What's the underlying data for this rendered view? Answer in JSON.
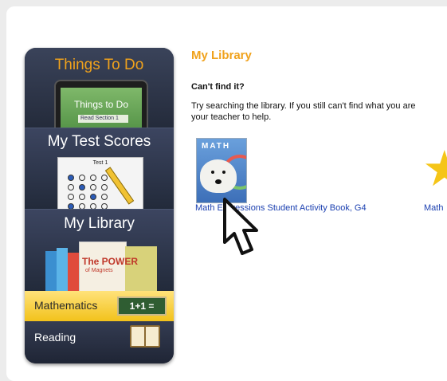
{
  "menu": {
    "things_to_do": {
      "title": "Things To Do",
      "tablet_label": "Things to Do",
      "tablet_sub": "Read Section 1"
    },
    "test_scores": {
      "title": "My Test Scores",
      "sheet_title": "Test 1"
    },
    "library": {
      "title": "My Library",
      "book_cover_title": "The POWER",
      "book_cover_sub": "of Magnets"
    },
    "subjects": [
      {
        "label": "Mathematics",
        "badge": "1+1 ="
      },
      {
        "label": "Reading"
      }
    ]
  },
  "main": {
    "heading": "My Library",
    "cant_find": "Can't find it?",
    "help_line1": "Try searching the library. If you still can't find what you are",
    "help_line2": "your teacher to help.",
    "books": [
      {
        "title": "Math Expressions Student Activity Book, G4",
        "cover_text": "MATH"
      },
      {
        "title": "Math"
      }
    ]
  },
  "colors": {
    "accent": "#f0a21c",
    "link": "#1a3fb0",
    "menu_bg": "#2b3346",
    "selected_row": "#f2c21b"
  },
  "icons": [
    "tablet-illustration",
    "test-sheet-illustration",
    "books-illustration",
    "chalkboard-icon",
    "open-book-icon",
    "star-icon",
    "cursor-arrow-icon"
  ]
}
